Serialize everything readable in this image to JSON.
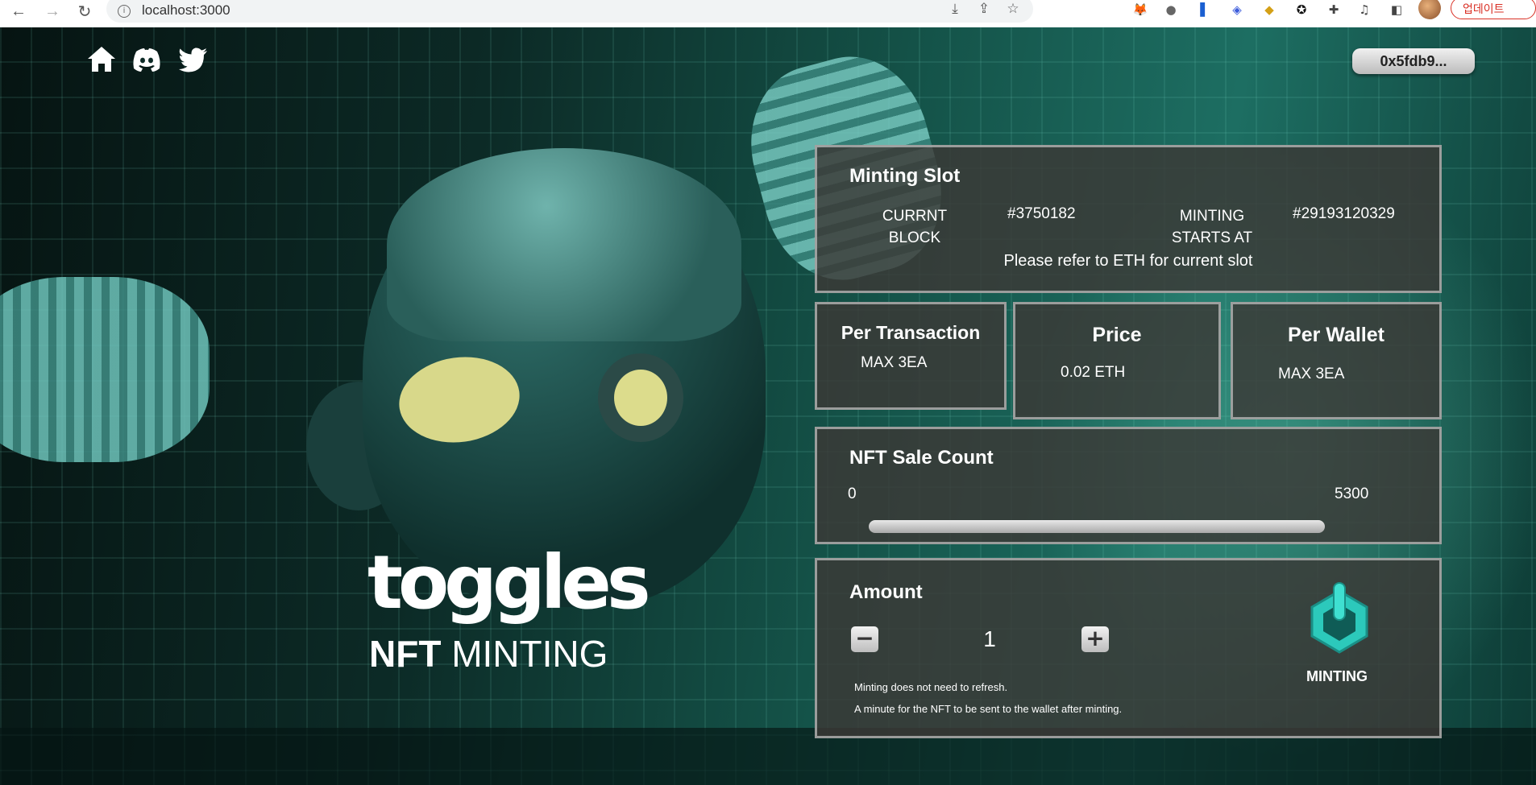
{
  "browser": {
    "url": "localhost:3000",
    "update_label": "업데이트"
  },
  "header": {
    "wallet_address": "0x5fdb9..."
  },
  "hero": {
    "logo_text": "toggles",
    "subtitle_bold": "NFT",
    "subtitle_rest": " MINTING"
  },
  "minting_slot": {
    "title": "Minting Slot",
    "current_block_label_1": "CURRNT",
    "current_block_label_2": "BLOCK",
    "current_block_value": "#3750182",
    "starts_label_1": "MINTING",
    "starts_label_2": "STARTS AT",
    "starts_value": "#29193120329",
    "note": "Please refer to ETH for current slot"
  },
  "per_transaction": {
    "title": "Per Transaction",
    "value": "MAX 3EA"
  },
  "price": {
    "title": "Price",
    "value": "0.02 ETH"
  },
  "per_wallet": {
    "title": "Per Wallet",
    "value": "MAX 3EA"
  },
  "sale_count": {
    "title": "NFT Sale Count",
    "min": "0",
    "max": "5300",
    "progress": 0
  },
  "amount": {
    "title": "Amount",
    "value": "1",
    "decrement": "−",
    "increment": "+",
    "note_1": "Minting does not need to refresh.",
    "note_2": "A minute for the NFT to be sent to the wallet after minting.",
    "mint_label": "MINTING"
  },
  "colors": {
    "accent": "#4fe3d2",
    "panel_bg": "#3c3836",
    "upgrade_red": "#d93025"
  }
}
